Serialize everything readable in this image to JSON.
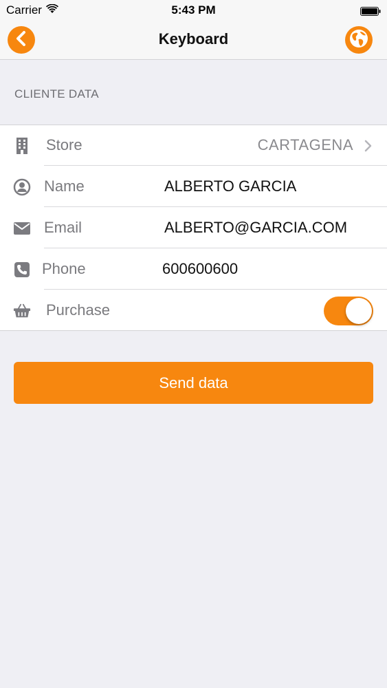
{
  "status_bar": {
    "carrier": "Carrier",
    "time": "5:43 PM"
  },
  "nav": {
    "title": "Keyboard",
    "back_icon": "chevron-left-icon",
    "right_icon": "globe-icon"
  },
  "section": {
    "header": "CLIENTE DATA"
  },
  "rows": [
    {
      "icon": "building-icon",
      "label": "Store",
      "detail": "CARTAGENA"
    },
    {
      "icon": "user-icon",
      "label": "Name",
      "value": "ALBERTO GARCIA"
    },
    {
      "icon": "envelope-icon",
      "label": "Email",
      "value": "ALBERTO@GARCIA.COM"
    },
    {
      "icon": "phone-icon",
      "label": "Phone",
      "value": "600600600"
    },
    {
      "icon": "basket-icon",
      "label": "Purchase",
      "toggle_on": true
    }
  ],
  "send_button": {
    "label": "Send data"
  },
  "colors": {
    "accent": "#f7870f",
    "background": "#efeff4",
    "label": "#7a7a7e",
    "icon": "#7b7b80"
  }
}
